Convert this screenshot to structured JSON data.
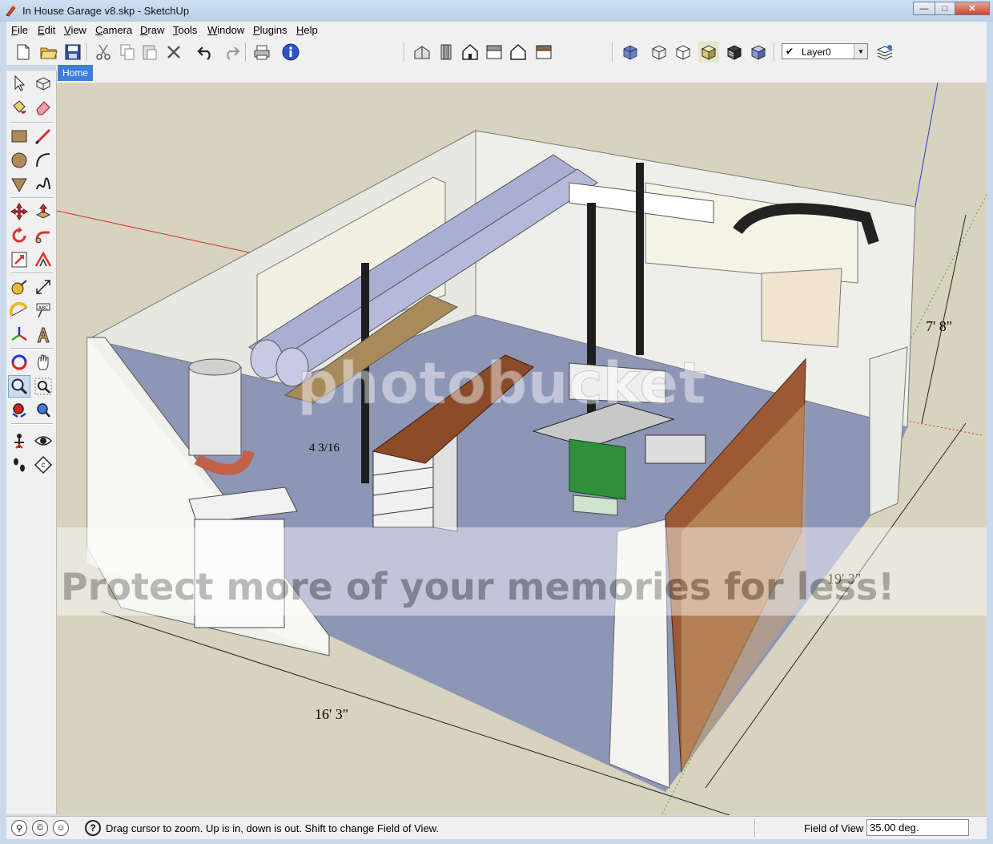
{
  "window": {
    "title": "In House Garage v8.skp - SketchUp",
    "controls": {
      "minimize": "—",
      "maximize": "□",
      "close": "✕"
    }
  },
  "menu": {
    "items": [
      {
        "key": "F",
        "rest": "ile"
      },
      {
        "key": "E",
        "rest": "dit"
      },
      {
        "key": "V",
        "rest": "iew"
      },
      {
        "key": "C",
        "rest": "amera"
      },
      {
        "key": "D",
        "rest": "raw"
      },
      {
        "key": "T",
        "rest": "ools"
      },
      {
        "key": "W",
        "rest": "indow"
      },
      {
        "key": "P",
        "rest": "lugins"
      },
      {
        "key": "H",
        "rest": "elp"
      }
    ]
  },
  "toolbar": {
    "icons": [
      "new-file-icon",
      "open-file-icon",
      "save-icon",
      "cut-icon",
      "copy-icon",
      "paste-icon",
      "erase-icon",
      "undo-icon",
      "redo-icon",
      "print-icon",
      "model-info-icon",
      "iso-view-icon",
      "top-view-icon",
      "front-view-icon",
      "right-view-icon",
      "back-view-icon",
      "left-view-icon",
      "xray-style-icon",
      "wireframe-style-icon",
      "hidden-line-style-icon",
      "shaded-style-icon",
      "shaded-textures-style-icon",
      "monochrome-style-icon",
      "layers-manager-icon"
    ],
    "layer_value": "Layer0",
    "layer_check": "✔"
  },
  "tools": {
    "icons": [
      "select-icon",
      "make-component-icon",
      "paint-bucket-icon",
      "eraser-icon",
      "rectangle-icon",
      "line-icon",
      "circle-icon",
      "arc-icon",
      "polygon-icon",
      "freehand-icon",
      "move-icon",
      "push-pull-icon",
      "rotate-icon",
      "follow-me-icon",
      "scale-icon",
      "offset-icon",
      "tape-measure-icon",
      "dimension-icon",
      "protractor-icon",
      "text-icon",
      "axes-icon",
      "3d-text-icon",
      "orbit-icon",
      "pan-icon",
      "zoom-icon",
      "zoom-window-icon",
      "zoom-extents-icon",
      "previous-view-icon",
      "position-camera-icon",
      "look-around-icon",
      "walk-icon",
      "section-plane-icon"
    ]
  },
  "scene_tabs": [
    "Home"
  ],
  "viewport": {
    "dim_width": "16' 3\"",
    "dim_depth": "19' 3\"",
    "dim_height": "7' 8\"",
    "dim_small": "4 3/16",
    "watermark_brand": "photobucket",
    "watermark_slogan": "Protect more of your memories for less!",
    "colors": {
      "sky": "#d8d3be",
      "floor": "#8e96b6",
      "wall": "#eeeeea",
      "duct": "#a9aed3",
      "saw_base": "#2f8f3a",
      "wood": "#8b4a28",
      "axis_red": "#d42a2a",
      "axis_blue": "#2a3ad4",
      "axis_green": "#2bb34a"
    }
  },
  "status": {
    "icons": [
      "geo-location-icon",
      "credits-icon",
      "user-icon"
    ],
    "help": "?",
    "message": "Drag cursor to zoom.  Up is in, down is out. Shift to change Field of View.",
    "vcb_label": "Field of View",
    "vcb_value": "35.00 deg."
  }
}
